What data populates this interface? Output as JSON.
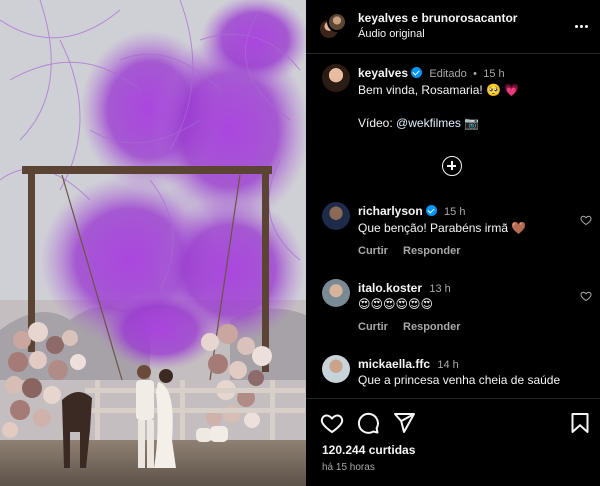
{
  "header": {
    "user1": "keyalves",
    "connector": "e",
    "user2": "brunorosacantor",
    "audio": "Áudio original"
  },
  "caption": {
    "user": "keyalves",
    "edited": "Editado",
    "time": "15 h",
    "text": "Bem vinda, Rosamaria! 🥺 💗",
    "video_label": "Vídeo:",
    "video_link": "@wekfilmes",
    "video_icon": "📷"
  },
  "comments": [
    {
      "user": "richarlyson",
      "verified": true,
      "time": "15 h",
      "text": "Que benção! Parabéns irmã 🤎",
      "like": "Curtir",
      "reply": "Responder"
    },
    {
      "user": "italo.koster",
      "verified": false,
      "time": "13 h",
      "text": "😍😍😍😍😍😍",
      "like": "Curtir",
      "reply": "Responder"
    },
    {
      "user": "mickaella.ffc",
      "verified": false,
      "time": "14 h",
      "text": "Que a princesa venha cheia de saúde"
    }
  ],
  "footer": {
    "likes": "120.244 curtidas",
    "ago": "há 15 horas"
  },
  "icons": {
    "more": "more-options-icon",
    "add": "add-circle-icon",
    "like": "heart-icon",
    "comment": "comment-icon",
    "share": "share-icon",
    "save": "bookmark-icon"
  },
  "colors": {
    "background": "#000000",
    "text": "#f5f5f5",
    "muted": "#a8a8a8",
    "verified": "#0095f6",
    "smoke": "#9b3fd0"
  }
}
